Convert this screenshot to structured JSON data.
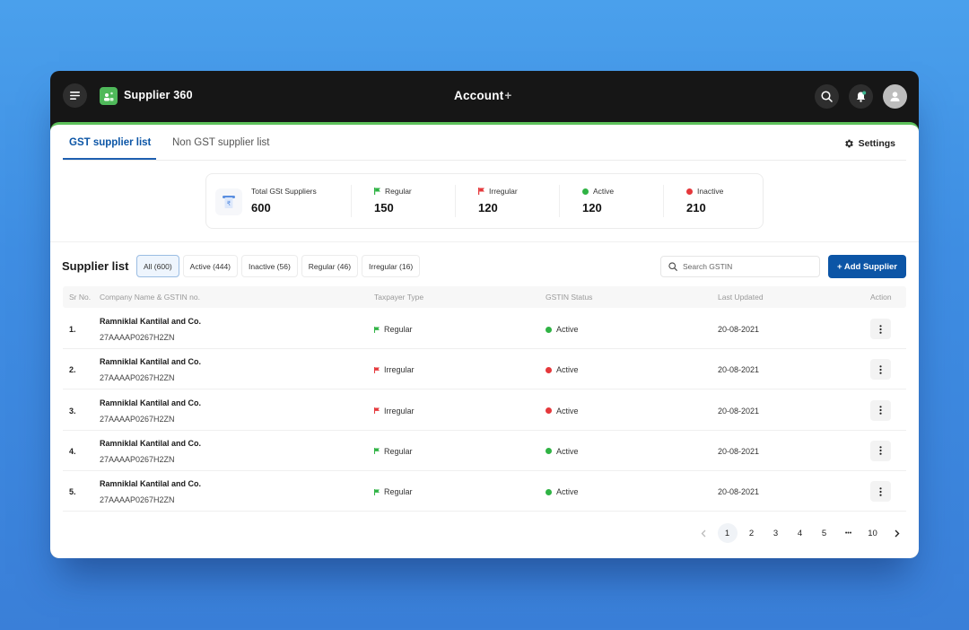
{
  "header": {
    "app_name": "Supplier 360",
    "brand_name": "Account",
    "brand_suffix": "+"
  },
  "tabs": [
    {
      "label": "GST supplier list",
      "active": true
    },
    {
      "label": "Non GST supplier list",
      "active": false
    }
  ],
  "settings_label": "Settings",
  "stats": {
    "total": {
      "label": "Total GSt Suppliers",
      "value": "600"
    },
    "regular": {
      "label": "Regular",
      "value": "150"
    },
    "irregular": {
      "label": "Irregular",
      "value": "120"
    },
    "active": {
      "label": "Active",
      "value": "120"
    },
    "inactive": {
      "label": "Inactive",
      "value": "210"
    }
  },
  "supplier_list": {
    "title": "Supplier list",
    "filters": [
      {
        "label": "All (600)",
        "selected": true
      },
      {
        "label": "Active (444)",
        "selected": false
      },
      {
        "label": "Inactive (56)",
        "selected": false
      },
      {
        "label": "Regular (46)",
        "selected": false
      },
      {
        "label": "Irregular (16)",
        "selected": false
      }
    ],
    "search_placeholder": "Search GSTIN",
    "search_value": "",
    "add_button_label": "+ Add Supplier"
  },
  "table": {
    "columns": [
      "Sr No.",
      "Company Name & GSTIN no.",
      "Taxpayer Type",
      "GSTIN Status",
      "Last Updated",
      "Action"
    ],
    "rows": [
      {
        "sr": "1.",
        "company": "Ramniklal Kantilal and Co.",
        "gstin": "27AAAAP0267H2ZN",
        "type": "Regular",
        "type_color": "#2fb344",
        "status": "Active",
        "status_color": "#2fb344",
        "updated": "20-08-2021"
      },
      {
        "sr": "2.",
        "company": "Ramniklal Kantilal and Co.",
        "gstin": "27AAAAP0267H2ZN",
        "type": "Irregular",
        "type_color": "#e5383b",
        "status": "Active",
        "status_color": "#e5383b",
        "updated": "20-08-2021"
      },
      {
        "sr": "3.",
        "company": "Ramniklal Kantilal and Co.",
        "gstin": "27AAAAP0267H2ZN",
        "type": "Irregular",
        "type_color": "#e5383b",
        "status": "Active",
        "status_color": "#e5383b",
        "updated": "20-08-2021"
      },
      {
        "sr": "4.",
        "company": "Ramniklal Kantilal and Co.",
        "gstin": "27AAAAP0267H2ZN",
        "type": "Regular",
        "type_color": "#2fb344",
        "status": "Active",
        "status_color": "#2fb344",
        "updated": "20-08-2021"
      },
      {
        "sr": "5.",
        "company": "Ramniklal Kantilal and Co.",
        "gstin": "27AAAAP0267H2ZN",
        "type": "Regular",
        "type_color": "#2fb344",
        "status": "Active",
        "status_color": "#2fb344",
        "updated": "20-08-2021"
      }
    ]
  },
  "pagination": {
    "pages": [
      "1",
      "2",
      "3",
      "4",
      "5",
      "•••",
      "10"
    ],
    "current": "1"
  },
  "colors": {
    "accent": "#0c55a6",
    "success": "#2fb344",
    "danger": "#e5383b",
    "brand_green": "#5dc15b"
  }
}
